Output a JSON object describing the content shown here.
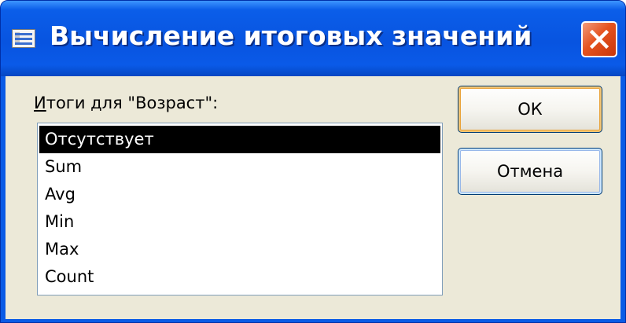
{
  "window": {
    "title": "Вычисление  итоговых значений",
    "close_icon": "close-x-icon",
    "app_icon": "form-window-icon"
  },
  "list": {
    "label_prefix": "И",
    "label_rest": "тоги для \"Возраст\":",
    "items": [
      "Отсутствует",
      "Sum",
      "Avg",
      "Min",
      "Max",
      "Count"
    ],
    "selected": "Отсутствует"
  },
  "buttons": {
    "ok_label": "ОК",
    "cancel_label": "Отмена"
  },
  "colors": {
    "titlebar": "#0854e0",
    "dialog_face": "#ece9d8",
    "close_button": "#e5531f",
    "selection": "#000000"
  }
}
